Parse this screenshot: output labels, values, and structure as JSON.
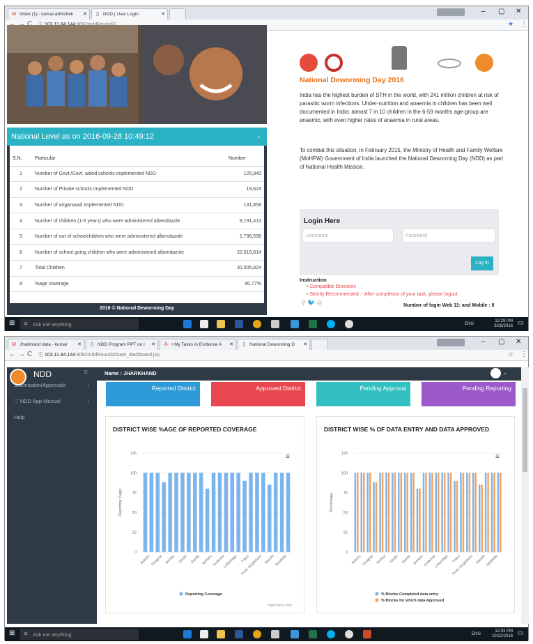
{
  "top": {
    "tabs": [
      {
        "label": "Inbox (1) - kumar.abhishek",
        "icon": "gmail-icon"
      },
      {
        "label": "NDD | User Login",
        "icon": "page-icon"
      }
    ],
    "url": {
      "host": "103.11.84.144",
      "path": ":8082/nddRound2/"
    },
    "panel_title": "National Level as on 2016-09-28 10:49:12",
    "table": {
      "headers": [
        "S.N.",
        "Particular",
        "Number"
      ],
      "rows": [
        [
          "1",
          "Number of Govt./Govt. aided schools implemented NDD",
          "125,940"
        ],
        [
          "2",
          "Number of Private schools implemented NDD",
          "19,624"
        ],
        [
          "3",
          "Number of anganwadi implemented NDD",
          "131,858"
        ],
        [
          "4",
          "Number of children (1-5 years) who were administered albendazole",
          "8,191,413"
        ],
        [
          "5",
          "Number of out of schoolchildren who were administered albendazole",
          "1,798,598"
        ],
        [
          "6",
          "Number of school going children who were administered albendazole",
          "20,515,814"
        ],
        [
          "7",
          "Total Children",
          "30,505,824"
        ],
        [
          "8",
          "%age coverage",
          "90.77%"
        ]
      ]
    },
    "footer": "2016 © National Deworming Day",
    "heading": "National Deworming Day 2016",
    "para1": "India has the highest burden of STH in the world, with 241 million children at risk of parasitic worm infections. Under-nutrition and anaemia in children has been well documented in India: almost 7 in 10 children in the 6-59 months age-group are anaemic, with even higher rates of anaemia in rural areas.",
    "para2": "To combat this situation, in February 2015, the Ministry of Health and Family Welfare (MoHFW) Government of India launched the National Deworming Day (NDD) as part of National Health Mission.",
    "login": {
      "title": "Login Here",
      "username_placeholder": "Username",
      "password_placeholder": "Password",
      "button": "Log In"
    },
    "instruction": {
      "title": "Instruction",
      "items": [
        "Compatible Browsers",
        "Strictly Recommended :- After completion of your task, please logout"
      ]
    },
    "login_count": "Number of login Web 11: and Mobile : 0",
    "taskbar": {
      "search": "Ask me anything",
      "lang": "ENG",
      "time": "12:29 PM",
      "date": "9/28/2016"
    }
  },
  "bottom": {
    "tabs": [
      {
        "label": "Jharkhand data - kumar",
        "icon": "gmail-icon"
      },
      {
        "label": "NDD Program PPT on I",
        "icon": "page-icon"
      },
      {
        "label": "• My Tasks in Evidence A",
        "icon": "asana-icon"
      },
      {
        "label": "National Deworming D",
        "icon": "page-icon"
      }
    ],
    "url": {
      "host": "103.11.84.144",
      "path": ":8082/nddRound2/state_dashboard.jsp"
    },
    "brand": "NDD",
    "user_name": "Name : JHARKHAND",
    "sidebar": [
      "Submission/Approvals",
      "NDD App Manual",
      "Help"
    ],
    "cards": [
      {
        "label": "Reported District",
        "color": "#2d9bd8"
      },
      {
        "label": "Approved District",
        "color": "#e8474f"
      },
      {
        "label": "Pending Approval",
        "color": "#32c0c0"
      },
      {
        "label": "Pending Reporting",
        "color": "#9b59c9"
      }
    ],
    "credit": "Highcharts.com",
    "taskbar": {
      "search": "Ask me anything",
      "lang": "ENG",
      "time": "12:03 PM",
      "date": "10/12/2016"
    }
  },
  "chart_data": [
    {
      "type": "bar",
      "title": "DISTRICT WISE %AGE OF REPORTED COVERAGE",
      "ylabel": "Reporting %age",
      "ylim": [
        0,
        125
      ],
      "yticks": [
        0,
        25,
        50,
        75,
        100,
        125
      ],
      "color": "#7cb5ec",
      "categories": [
        "Bokaro",
        "Deoghar",
        "Dumka",
        "Giridih",
        "Gumla",
        "Jamtara",
        "Koderma",
        "Lohardaga",
        "Pakur",
        "Purbi Singhbhum",
        "Ranchi",
        "Saraikela"
      ],
      "series": [
        {
          "name": "Reporting Coverage",
          "values": [
            100,
            100,
            100,
            88,
            100,
            100,
            100,
            100,
            100,
            100,
            80,
            100,
            100,
            100,
            100,
            100,
            90,
            100,
            100,
            100,
            85,
            100,
            100,
            100
          ]
        }
      ]
    },
    {
      "type": "bar",
      "title": "DISTRICT WISE % OF DATA ENTRY AND DATA APPROVED",
      "ylabel": "Percentage",
      "ylim": [
        0,
        125
      ],
      "yticks": [
        0,
        25,
        50,
        75,
        100,
        125
      ],
      "colors": [
        "#7cb5ec",
        "#f7a35c"
      ],
      "categories": [
        "Bokaro",
        "Deoghar",
        "Dumka",
        "Giridih",
        "Gumla",
        "Jamtara",
        "Koderma",
        "Lohardaga",
        "Pakur",
        "Purbi Singhbhum",
        "Ranchi",
        "Saraikela"
      ],
      "series": [
        {
          "name": "% Blocks Completed data entry",
          "values": [
            100,
            100,
            100,
            88,
            100,
            100,
            100,
            100,
            100,
            100,
            80,
            100,
            100,
            100,
            100,
            100,
            90,
            100,
            100,
            100,
            85,
            100,
            100,
            100
          ]
        },
        {
          "name": "% Blocks for which data Approved",
          "values": [
            100,
            100,
            100,
            88,
            100,
            100,
            100,
            100,
            100,
            100,
            80,
            100,
            100,
            100,
            100,
            100,
            90,
            100,
            100,
            100,
            85,
            100,
            100,
            100
          ]
        }
      ]
    }
  ]
}
